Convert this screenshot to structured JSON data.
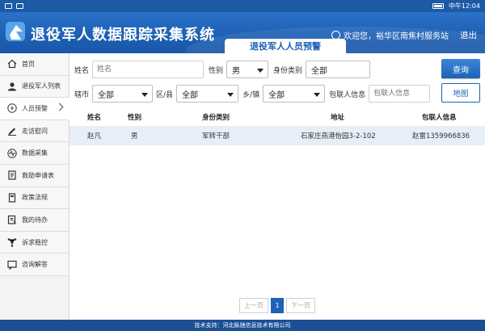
{
  "statusbar": {
    "carrier_left": "",
    "network": "中午12:04"
  },
  "header": {
    "app_title": "退役军人数据跟踪采集系统",
    "page_tab": "退役军人人员预警",
    "welcome": "欢迎您，裕华区南焦村服务站",
    "logout": "退出"
  },
  "sidebar": {
    "items": [
      {
        "label": "首页",
        "icon": "home-icon"
      },
      {
        "label": "退役军人列表",
        "icon": "user-icon"
      },
      {
        "label": "人员预警",
        "icon": "lightning-icon",
        "active": true
      },
      {
        "label": "走访慰问",
        "icon": "pen-icon"
      },
      {
        "label": "数据采集",
        "icon": "pulse-icon"
      },
      {
        "label": "救助申请表",
        "icon": "form-icon"
      },
      {
        "label": "政策法规",
        "icon": "book-icon"
      },
      {
        "label": "我的待办",
        "icon": "todo-icon"
      },
      {
        "label": "诉求稳控",
        "icon": "network-icon"
      },
      {
        "label": "咨询解答",
        "icon": "chat-icon"
      }
    ]
  },
  "filters": {
    "name_label": "姓名",
    "name_placeholder": "姓名",
    "gender_label": "性别",
    "gender_value": "男",
    "identity_label": "身份类别",
    "identity_value": "全部",
    "query_button": "查询",
    "city_label": "辖市",
    "city_value": "全部",
    "district_label": "区/县",
    "district_value": "全部",
    "town_label": "乡/镇",
    "town_value": "全部",
    "contact_label": "包联人信息",
    "contact_placeholder": "包联人信息",
    "map_button": "地图"
  },
  "table": {
    "headers": [
      "姓名",
      "性别",
      "身份类别",
      "地址",
      "包联人信息"
    ],
    "rows": [
      [
        "赵凡",
        "男",
        "军转干部",
        "石家庄燕港怡园3-2-102",
        "赵雷13599668​36"
      ]
    ]
  },
  "pager": {
    "prev": "上一页",
    "current": "1",
    "next": "下一页"
  },
  "footer": {
    "text": "技术支持：河北枞驰信息技术有限公司"
  },
  "colors": {
    "primary": "#1d63b8",
    "header": "#2a72c8",
    "row_highlight": "#e8eef8"
  }
}
